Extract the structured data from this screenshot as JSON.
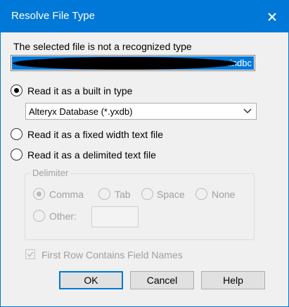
{
  "window": {
    "title": "Resolve File Type"
  },
  "prompt_text": "The selected file is not a recognized type",
  "file_path": {
    "visible_suffix": ".indbc"
  },
  "options": {
    "builtin": {
      "label": "Read it as a built in type",
      "checked": true
    },
    "builtin_select": {
      "value": "Alteryx Database (*.yxdb)"
    },
    "fixed_width": {
      "label": "Read it as a fixed width text file",
      "checked": false
    },
    "delimited": {
      "label": "Read it as a delimited text file",
      "checked": false
    }
  },
  "delimiter": {
    "legend": "Delimiter",
    "comma": "Comma",
    "tab": "Tab",
    "space": "Space",
    "none": "None",
    "other": "Other:",
    "other_value": ""
  },
  "first_row": {
    "label": "First Row Contains Field Names",
    "checked": true
  },
  "buttons": {
    "ok": "OK",
    "cancel": "Cancel",
    "help": "Help"
  },
  "colors": {
    "titlebar": "#0078d7",
    "selection": "#0078d7",
    "disabled": "#a0a0a0"
  }
}
